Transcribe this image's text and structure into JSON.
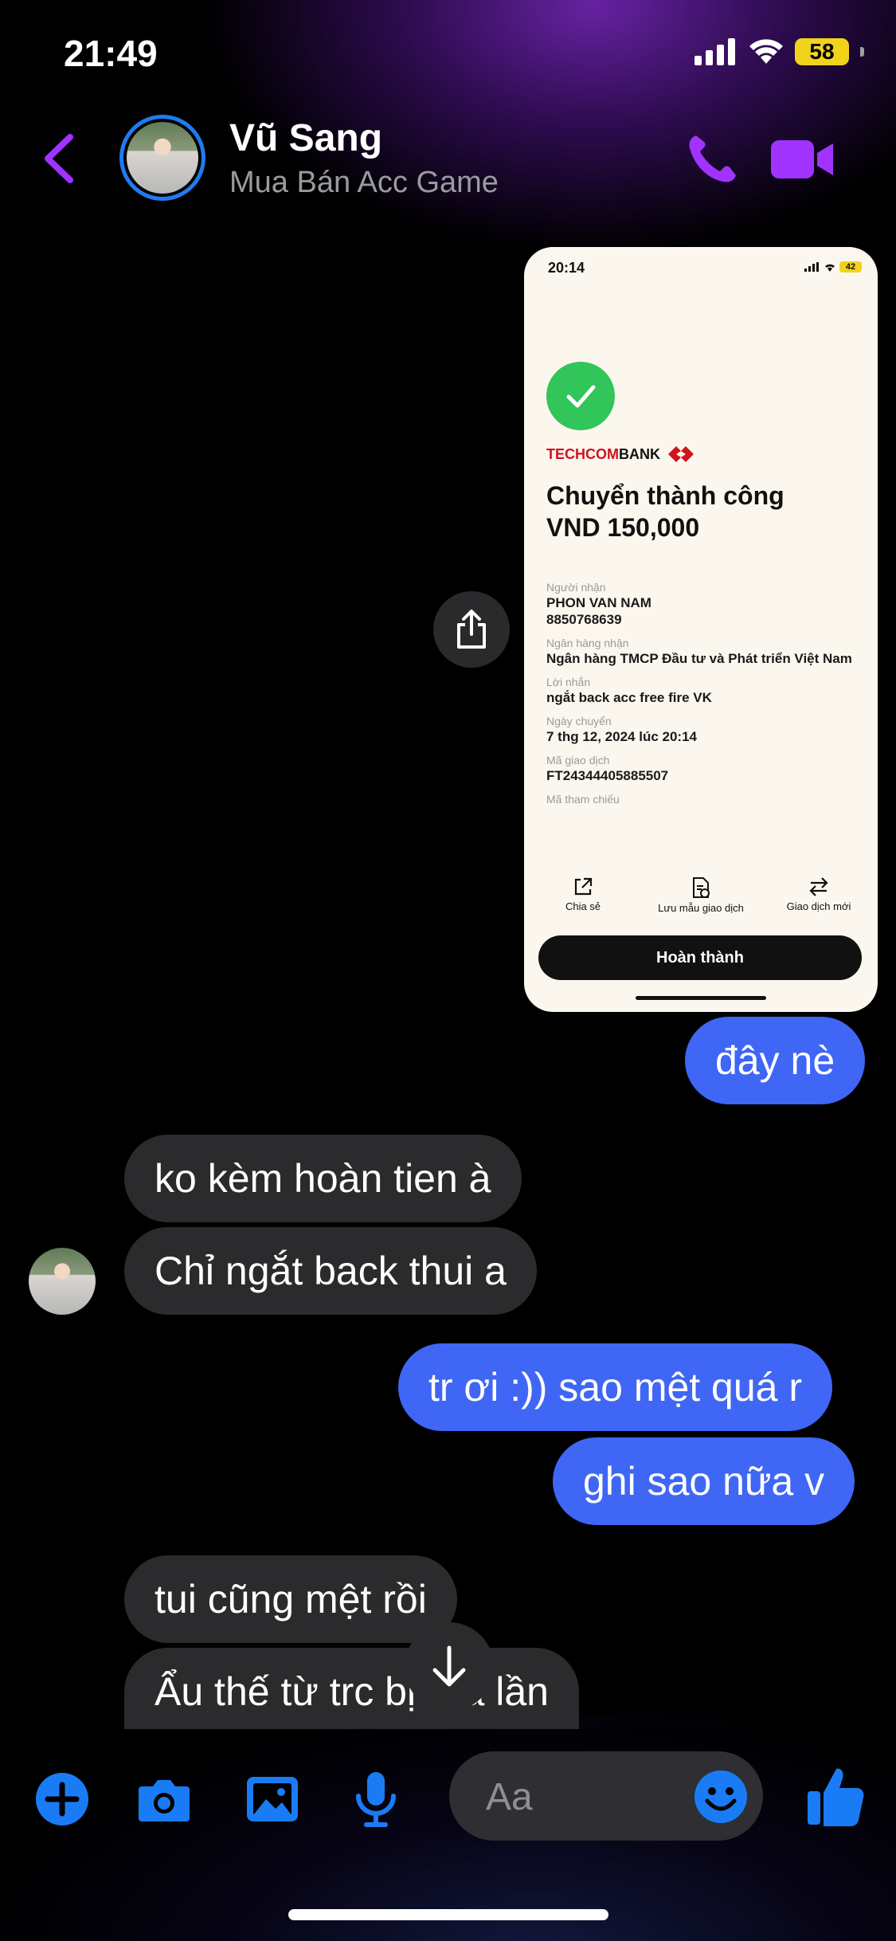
{
  "status_bar": {
    "time": "21:49",
    "battery": "58"
  },
  "header": {
    "name": "Vũ Sang",
    "subtitle": "Mua Bán Acc Game"
  },
  "shared_image": {
    "time": "20:14",
    "battery": "42",
    "bank_name_red": "TECHCOM",
    "bank_name_black": "BANK",
    "title": "Chuyển thành công",
    "amount": "VND 150,000",
    "fields": [
      {
        "label": "Người nhận",
        "value": "PHON VAN NAM\n8850768639"
      },
      {
        "label": "Ngân hàng nhận",
        "value": "Ngân hàng TMCP Đầu tư và Phát triển Việt Nam"
      },
      {
        "label": "Lời nhắn",
        "value": "ngắt back acc free fire VK"
      },
      {
        "label": "Ngày chuyển",
        "value": "7 thg 12, 2024 lúc 20:14"
      },
      {
        "label": "Mã giao dịch",
        "value": "FT24344405885507"
      },
      {
        "label": "Mã tham chiếu",
        "value": ""
      }
    ],
    "actions": [
      "Chia sẻ",
      "Lưu mẫu giao dịch",
      "Giao dịch mới"
    ],
    "done_label": "Hoàn thành"
  },
  "messages": [
    {
      "side": "out",
      "text": "đây nè"
    },
    {
      "side": "in",
      "text": "ko kèm hoàn tien à"
    },
    {
      "side": "in",
      "text": "Chỉ ngắt back thui a"
    },
    {
      "side": "out",
      "text": "tr ơi :)) sao mệt quá r"
    },
    {
      "side": "out",
      "text": "ghi sao nữa v"
    },
    {
      "side": "in",
      "text": "tui cũng mệt rồi"
    },
    {
      "side": "in",
      "text": "Ẩu thế từ trc bị lừa lần"
    }
  ],
  "composer": {
    "placeholder": "Aa"
  },
  "colors": {
    "accent": "#a033ff",
    "outgoing": "#3f66f5",
    "incoming": "#2b2b2d",
    "icon_blue": "#1a7cf5"
  }
}
